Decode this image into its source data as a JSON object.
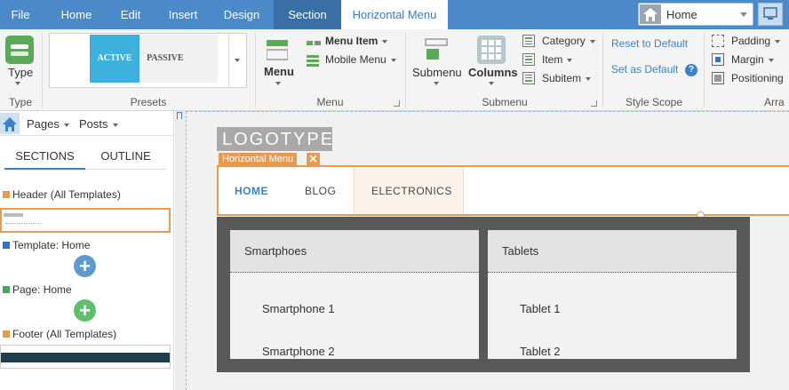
{
  "menu_tabs": [
    {
      "label": "File"
    },
    {
      "label": "Home"
    },
    {
      "label": "Edit"
    },
    {
      "label": "Insert"
    },
    {
      "label": "Design"
    },
    {
      "label": "Section"
    },
    {
      "label": "Horizontal Menu"
    }
  ],
  "page_select": {
    "value": "Home"
  },
  "ribbon": {
    "type": {
      "label": "Type",
      "group": "Type"
    },
    "presets": {
      "group": "Presets",
      "active": "ACTIVE",
      "passive": "PASSIVE"
    },
    "menu": {
      "group": "Menu",
      "menu_label": "Menu",
      "menu_item": "Menu Item",
      "mobile_menu": "Mobile Menu"
    },
    "submenu": {
      "group": "Submenu",
      "submenu_label": "Submenu",
      "columns_label": "Columns",
      "category": "Category",
      "item": "Item",
      "subitem": "Subitem"
    },
    "style_scope": {
      "group": "Style Scope",
      "reset": "Reset to Default",
      "set_default": "Set as Default",
      "help": "?"
    },
    "arrange": {
      "group": "Arra",
      "padding": "Padding",
      "margin": "Margin",
      "positioning": "Positioning"
    }
  },
  "left_panel": {
    "pages": "Pages",
    "posts": "Posts",
    "tabs": [
      "SECTIONS",
      "OUTLINE"
    ],
    "tree": [
      {
        "label": "Header (All Templates)",
        "color": "#e89b4e"
      },
      {
        "label": "Template: Home",
        "color": "#3a6fc8"
      },
      {
        "label": "Page: Home",
        "color": "#4aa564"
      },
      {
        "label": "Footer (All Templates)",
        "color": "#e89b4e"
      }
    ],
    "add_blue": "#5b9bd0",
    "add_green": "#5fbf6a"
  },
  "canvas": {
    "logo": "LOGOTYPE",
    "tag": "Horizontal Menu",
    "tag_close": "✕",
    "menu_items": [
      "HOME",
      "BLOG",
      "ELECTRONICS"
    ],
    "dropdown": [
      {
        "heading": "Smartphoes",
        "items": [
          "Smartphone 1",
          "Smartphone 2"
        ]
      },
      {
        "heading": "Tablets",
        "items": [
          "Tablet 1",
          "Tablet 2"
        ]
      }
    ]
  }
}
